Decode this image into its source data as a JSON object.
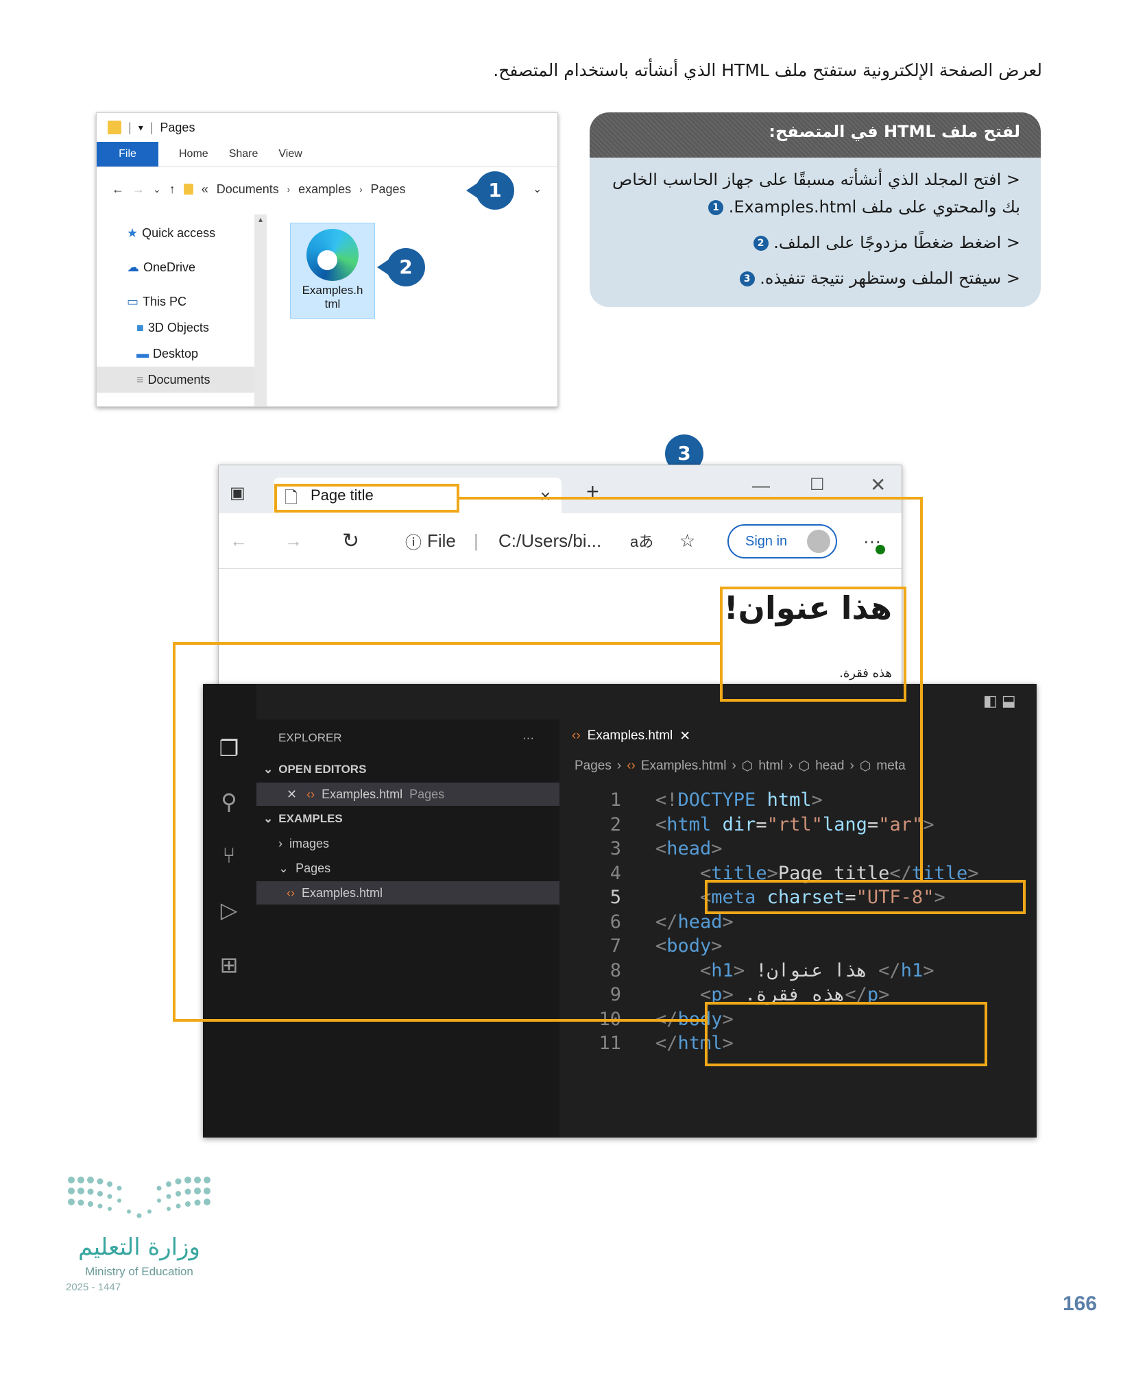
{
  "intro": {
    "text": "لعرض الصفحة الإلكترونية ستفتح ملف HTML الذي أنشأته باستخدام المتصفح."
  },
  "instructions": {
    "heading": "لفتح ملف HTML في المتصفح:",
    "steps": [
      {
        "text": "افتح المجلد الذي أنشأته مسبقًا على جهاز الحاسب الخاص بك والمحتوي على ملف Examples.html.",
        "badge": "1"
      },
      {
        "text": "اضغط ضغطًا مزدوجًا على الملف.",
        "badge": "2"
      },
      {
        "text": "سيفتح الملف وستظهر نتيجة تنفيذه.",
        "badge": "3"
      }
    ],
    "bullet": "<"
  },
  "explorer": {
    "title": "Pages",
    "ribbon": {
      "file": "File",
      "home": "Home",
      "share": "Share",
      "view": "View"
    },
    "address": {
      "chev": "«",
      "p1": "Documents",
      "p2": "examples",
      "p3": "Pages"
    },
    "nav": [
      "Quick access",
      "OneDrive",
      "This PC",
      "3D Objects",
      "Desktop",
      "Documents"
    ],
    "file_name_1": "Examples.h",
    "file_name_2": "tml"
  },
  "callouts": [
    "1",
    "2",
    "3"
  ],
  "browser": {
    "tab_title": "Page title",
    "tab_close": "×",
    "new_tab": "+",
    "scheme": "File",
    "url": "C:/Users/bi...",
    "sign_in": "Sign in",
    "heading": "هذا عنوان!",
    "paragraph": "هذه فقرة."
  },
  "vscode": {
    "explorer_label": "EXPLORER",
    "more": "···",
    "open_editors": "OPEN EDITORS",
    "open_file": "Examples.html",
    "open_file_folder": "Pages",
    "examples": "EXAMPLES",
    "images": "images",
    "pages": "Pages",
    "tree_file": "Examples.html",
    "tab": "Examples.html",
    "crumbs": [
      "Pages",
      "Examples.html",
      "html",
      "head",
      "meta"
    ],
    "lines": [
      {
        "n": "1",
        "parts": [
          [
            "tag",
            "<!"
          ],
          [
            "tn",
            "DOCTYPE"
          ],
          [
            "tx",
            " "
          ],
          [
            "an",
            "html"
          ],
          [
            "tag",
            ">"
          ]
        ]
      },
      {
        "n": "2",
        "parts": [
          [
            "tag",
            "<"
          ],
          [
            "tn",
            "html"
          ],
          [
            "tx",
            " "
          ],
          [
            "an",
            "dir"
          ],
          [
            "tx",
            "="
          ],
          [
            "av",
            "\"rtl\""
          ],
          [
            "an",
            "lang"
          ],
          [
            "tx",
            "="
          ],
          [
            "av",
            "\"ar\""
          ],
          [
            "tag",
            ">"
          ]
        ]
      },
      {
        "n": "3",
        "parts": [
          [
            "tag",
            "<"
          ],
          [
            "tn",
            "head"
          ],
          [
            "tag",
            ">"
          ]
        ]
      },
      {
        "n": "4",
        "parts": [
          [
            "tx",
            "    "
          ],
          [
            "tag",
            "<"
          ],
          [
            "tn",
            "title"
          ],
          [
            "tag",
            ">"
          ],
          [
            "tx",
            "Page title"
          ],
          [
            "tag",
            "</"
          ],
          [
            "tn",
            "title"
          ],
          [
            "tag",
            ">"
          ]
        ]
      },
      {
        "n": "5",
        "parts": [
          [
            "tx",
            "    "
          ],
          [
            "tag",
            "<"
          ],
          [
            "tn",
            "meta"
          ],
          [
            "tx",
            " "
          ],
          [
            "an",
            "charset"
          ],
          [
            "tx",
            "="
          ],
          [
            "av",
            "\"UTF-8\""
          ],
          [
            "tag",
            ">"
          ]
        ]
      },
      {
        "n": "6",
        "parts": [
          [
            "tag",
            "</"
          ],
          [
            "tn",
            "head"
          ],
          [
            "tag",
            ">"
          ]
        ]
      },
      {
        "n": "7",
        "parts": [
          [
            "tag",
            "<"
          ],
          [
            "tn",
            "body"
          ],
          [
            "tag",
            ">"
          ]
        ]
      },
      {
        "n": "8",
        "parts": [
          [
            "tx",
            "    "
          ],
          [
            "tag",
            "<"
          ],
          [
            "tn",
            "h1"
          ],
          [
            "tag",
            "> "
          ],
          [
            "tx",
            "!هذا عنوان "
          ],
          [
            "tag",
            "</"
          ],
          [
            "tn",
            "h1"
          ],
          [
            "tag",
            ">"
          ]
        ]
      },
      {
        "n": "9",
        "parts": [
          [
            "tx",
            "    "
          ],
          [
            "tag",
            "<"
          ],
          [
            "tn",
            "p"
          ],
          [
            "tag",
            "> "
          ],
          [
            "tx",
            ".هذه فقرة"
          ],
          [
            "tag",
            "</"
          ],
          [
            "tn",
            "p"
          ],
          [
            "tag",
            ">"
          ]
        ]
      },
      {
        "n": "10",
        "parts": [
          [
            "tag",
            "</"
          ],
          [
            "tn",
            "body"
          ],
          [
            "tag",
            ">"
          ]
        ]
      },
      {
        "n": "11",
        "parts": [
          [
            "tag",
            "</"
          ],
          [
            "tn",
            "html"
          ],
          [
            "tag",
            ">"
          ]
        ]
      }
    ]
  },
  "footer": {
    "ministry_ar": "وزارة التعليم",
    "ministry_en": "Ministry of Education",
    "year": "2025 - 1447",
    "page_number": "166"
  },
  "colors": {
    "accent": "#f0a818",
    "badge": "#1a5fa0",
    "box_bg": "#d4e1ea"
  }
}
